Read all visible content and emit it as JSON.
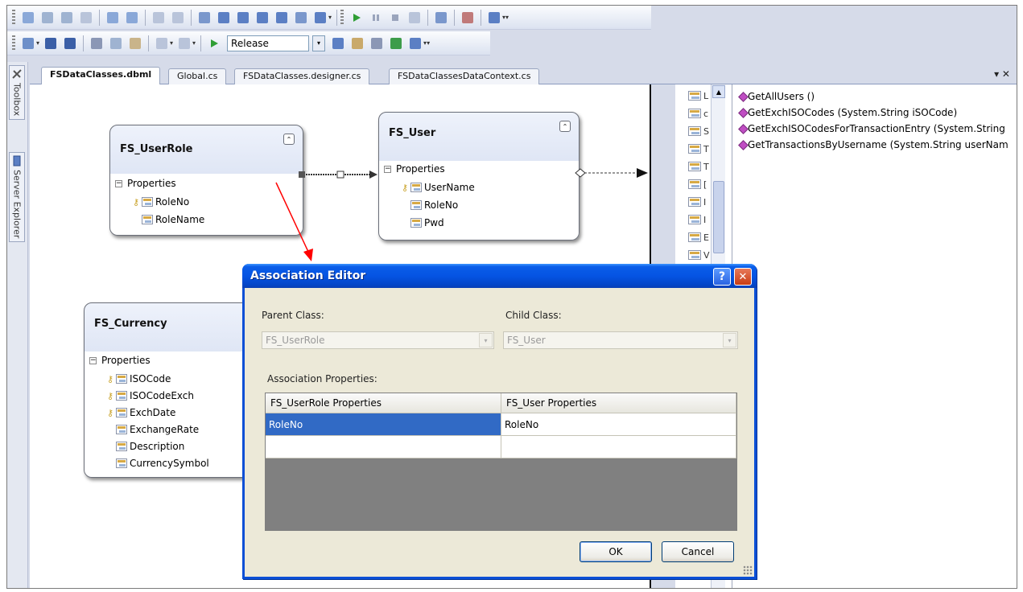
{
  "toolbar": {
    "configuration": "Release"
  },
  "side": {
    "toolbox_label": "Toolbox",
    "server_explorer_label": "Server Explorer"
  },
  "tabs": [
    {
      "label": "FSDataClasses.dbml",
      "active": true
    },
    {
      "label": "Global.cs",
      "active": false
    },
    {
      "label": "FSDataClasses.designer.cs",
      "active": false
    },
    {
      "label": "FSDataClassesDataContext.cs",
      "active": false
    }
  ],
  "tab_controls": "▾ ✕",
  "entities": {
    "user_role": {
      "title": "FS_UserRole",
      "props_header": "Properties",
      "props": [
        {
          "name": "RoleNo",
          "key": true
        },
        {
          "name": "RoleName",
          "key": false
        }
      ]
    },
    "user": {
      "title": "FS_User",
      "props_header": "Properties",
      "props": [
        {
          "name": "UserName",
          "key": true
        },
        {
          "name": "RoleNo",
          "key": false
        },
        {
          "name": "Pwd",
          "key": false
        }
      ]
    },
    "currency": {
      "title": "FS_Currency",
      "props_header": "Properties",
      "props": [
        {
          "name": "ISOCode",
          "key": true
        },
        {
          "name": "ISOCodeExch",
          "key": true
        },
        {
          "name": "ExchDate",
          "key": true
        },
        {
          "name": "ExchangeRate",
          "key": false
        },
        {
          "name": "Description",
          "key": false
        },
        {
          "name": "CurrencySymbol",
          "key": false
        }
      ]
    }
  },
  "mini_list_chars": [
    "L",
    "c",
    "S",
    "T",
    "T",
    "[",
    "I",
    "I",
    "E",
    "V"
  ],
  "methods": [
    "GetAllUsers ()",
    "GetExchISOCodes (System.String iSOCode)",
    "GetExchISOCodesForTransactionEntry (System.String",
    "GetTransactionsByUsername (System.String userNam"
  ],
  "dialog": {
    "title": "Association Editor",
    "help_label": "?",
    "close_label": "✕",
    "parent_class_label": "Parent Class:",
    "parent_class_value": "FS_UserRole",
    "child_class_label": "Child Class:",
    "child_class_value": "FS_User",
    "association_properties_label": "Association Properties:",
    "grid": {
      "headers": [
        "FS_UserRole Properties",
        "FS_User Properties"
      ],
      "rows": [
        [
          "RoleNo",
          "RoleNo"
        ],
        [
          "",
          ""
        ]
      ]
    },
    "ok_label": "OK",
    "cancel_label": "Cancel"
  },
  "colors": {
    "dialog_title_bar": "#0554e3",
    "selection": "#316ac5",
    "annotation_arrow": "#ff0000"
  }
}
